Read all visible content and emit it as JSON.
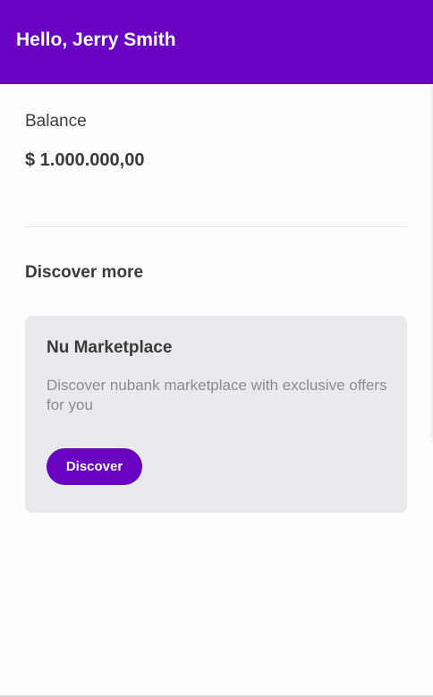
{
  "header": {
    "title": "Hello, Jerry Smith"
  },
  "balance": {
    "label": "Balance",
    "value": "$ 1.000.000,00"
  },
  "discover": {
    "section_title": "Discover more",
    "card": {
      "title": "Nu Marketplace",
      "description": "Discover nubank marketplace with exclusive offers for you",
      "button_label": "Discover"
    }
  },
  "colors": {
    "brand_purple": "#6a02c2",
    "card_background": "#e9eaee",
    "page_background": "#fdfdfd"
  }
}
